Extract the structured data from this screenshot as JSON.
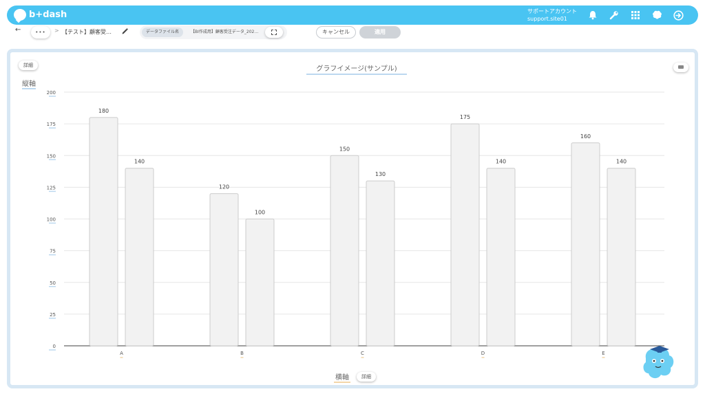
{
  "header": {
    "logo_text": "b+dash",
    "account_name": "サポートアカウント",
    "account_id": "support.site01",
    "icons": [
      "bell-icon",
      "wrench-icon",
      "grid-icon",
      "brain-icon",
      "logout-icon"
    ]
  },
  "toolbar": {
    "back": "←",
    "more": "•••",
    "separator": ">",
    "breadcrumb": "【テスト】顧客受…",
    "datafile_label": "データファイル名",
    "datafile_value": "【BI作成用】顧客受注データ_202…",
    "cancel_label": "キャンセル",
    "apply_label": "適用"
  },
  "panel": {
    "detail_top": "詳細",
    "detail_bottom": "詳細",
    "chart_title": "グラフイメージ(サンプル)",
    "y_axis_label": "縦軸",
    "x_axis_label": "横軸"
  },
  "chart_data": {
    "type": "bar",
    "title": "グラフイメージ(サンプル)",
    "xlabel": "横軸",
    "ylabel": "縦軸",
    "categories": [
      "A",
      "B",
      "C",
      "D",
      "E"
    ],
    "series": [
      {
        "values": [
          180,
          120,
          150,
          175,
          160
        ]
      },
      {
        "values": [
          140,
          100,
          130,
          140,
          140
        ]
      }
    ],
    "ylim": [
      0,
      200
    ],
    "yticks": [
      0,
      25,
      50,
      75,
      100,
      125,
      150,
      175,
      200
    ],
    "grid": true,
    "bar_color": "#f2f2f2",
    "bar_border": "#cccccc"
  },
  "colors": {
    "accent": "#49c4f2",
    "panel_border": "#d7e7f4"
  }
}
